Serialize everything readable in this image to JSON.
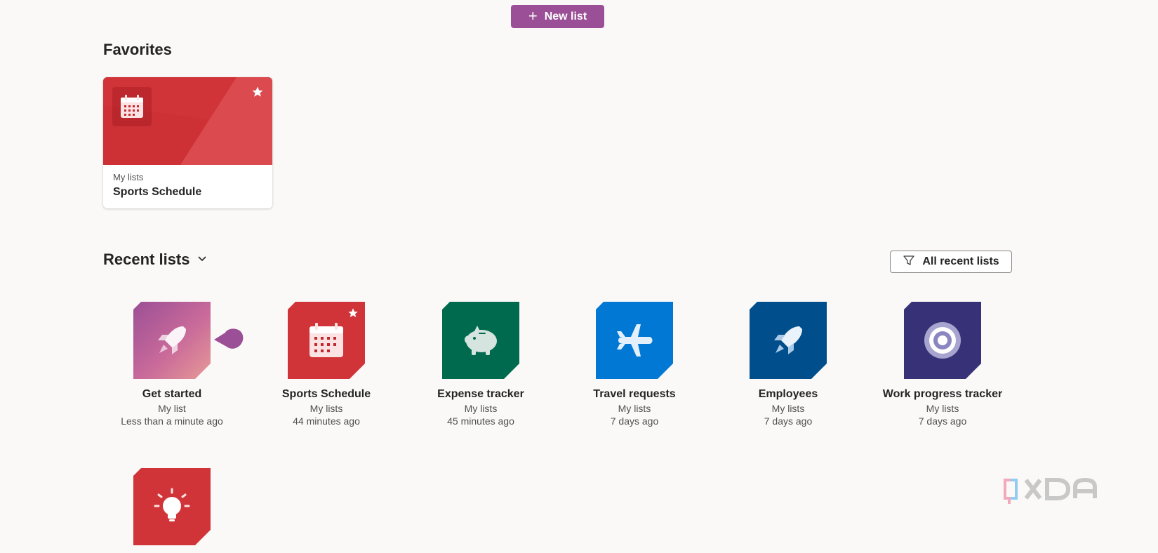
{
  "toolbar": {
    "new_list_label": "New list"
  },
  "favorites": {
    "title": "Favorites",
    "cards": [
      {
        "category": "My lists",
        "name": "Sports Schedule",
        "color": "#d13438",
        "icon": "calendar-icon",
        "favorited": true
      }
    ]
  },
  "recent": {
    "title": "Recent lists",
    "filter_label": "All recent lists",
    "items": [
      {
        "name": "Get started",
        "category": "My list",
        "time": "Less than a minute ago",
        "icon": "rocket-icon",
        "color": "#9b4f96"
      },
      {
        "name": "Sports Schedule",
        "category": "My lists",
        "time": "44 minutes ago",
        "icon": "calendar-icon",
        "color": "#d13438",
        "favorited": true
      },
      {
        "name": "Expense tracker",
        "category": "My lists",
        "time": "45 minutes ago",
        "icon": "piggy-bank-icon",
        "color": "#006a4e"
      },
      {
        "name": "Travel requests",
        "category": "My lists",
        "time": "7 days ago",
        "icon": "airplane-icon",
        "color": "#0078d4"
      },
      {
        "name": "Employees",
        "category": "My lists",
        "time": "7 days ago",
        "icon": "rocket-icon",
        "color": "#004e8c"
      },
      {
        "name": "Work progress tracker",
        "category": "My lists",
        "time": "7 days ago",
        "icon": "target-icon",
        "color": "#373277"
      },
      {
        "name": "",
        "category": "",
        "time": "",
        "icon": "lightbulb-icon",
        "color": "#d13438"
      }
    ]
  },
  "watermark": {
    "text": "XDA"
  }
}
